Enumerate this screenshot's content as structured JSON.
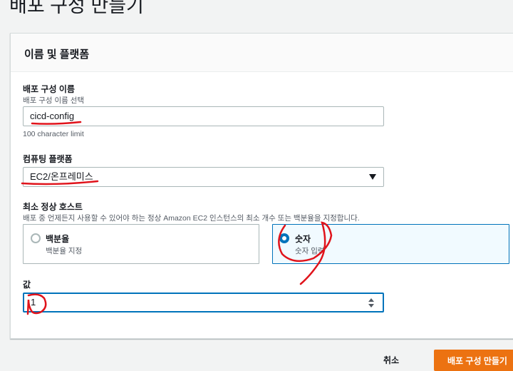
{
  "page": {
    "title": "배포 구성 만들기"
  },
  "panel": {
    "title": "이름 및 플랫폼",
    "name_field": {
      "label": "배포 구성 이름",
      "description": "배포 구성 이름 선택",
      "value": "cicd-config",
      "constraint": "100 character limit"
    },
    "platform_field": {
      "label": "컴퓨팅 플랫폼",
      "selected": "EC2/온프레미스"
    },
    "min_healthy_hosts": {
      "label": "최소 정상 호스트",
      "description": "배포 중 언제든지 사용할 수 있어야 하는 정상 Amazon EC2 인스턴스의 최소 개수 또는 백분율을 지정합니다.",
      "options": [
        {
          "label": "백분율",
          "description": "백분율 지정",
          "checked": false
        },
        {
          "label": "숫자",
          "description": "숫자 입력",
          "checked": true
        }
      ]
    },
    "value_field": {
      "label": "값",
      "value": "1"
    }
  },
  "footer": {
    "cancel_label": "취소",
    "create_label": "배포 구성 만들기"
  },
  "colors": {
    "accent": "#0073bb",
    "primary_button": "#ec7211",
    "annotation": "#e0131b"
  }
}
